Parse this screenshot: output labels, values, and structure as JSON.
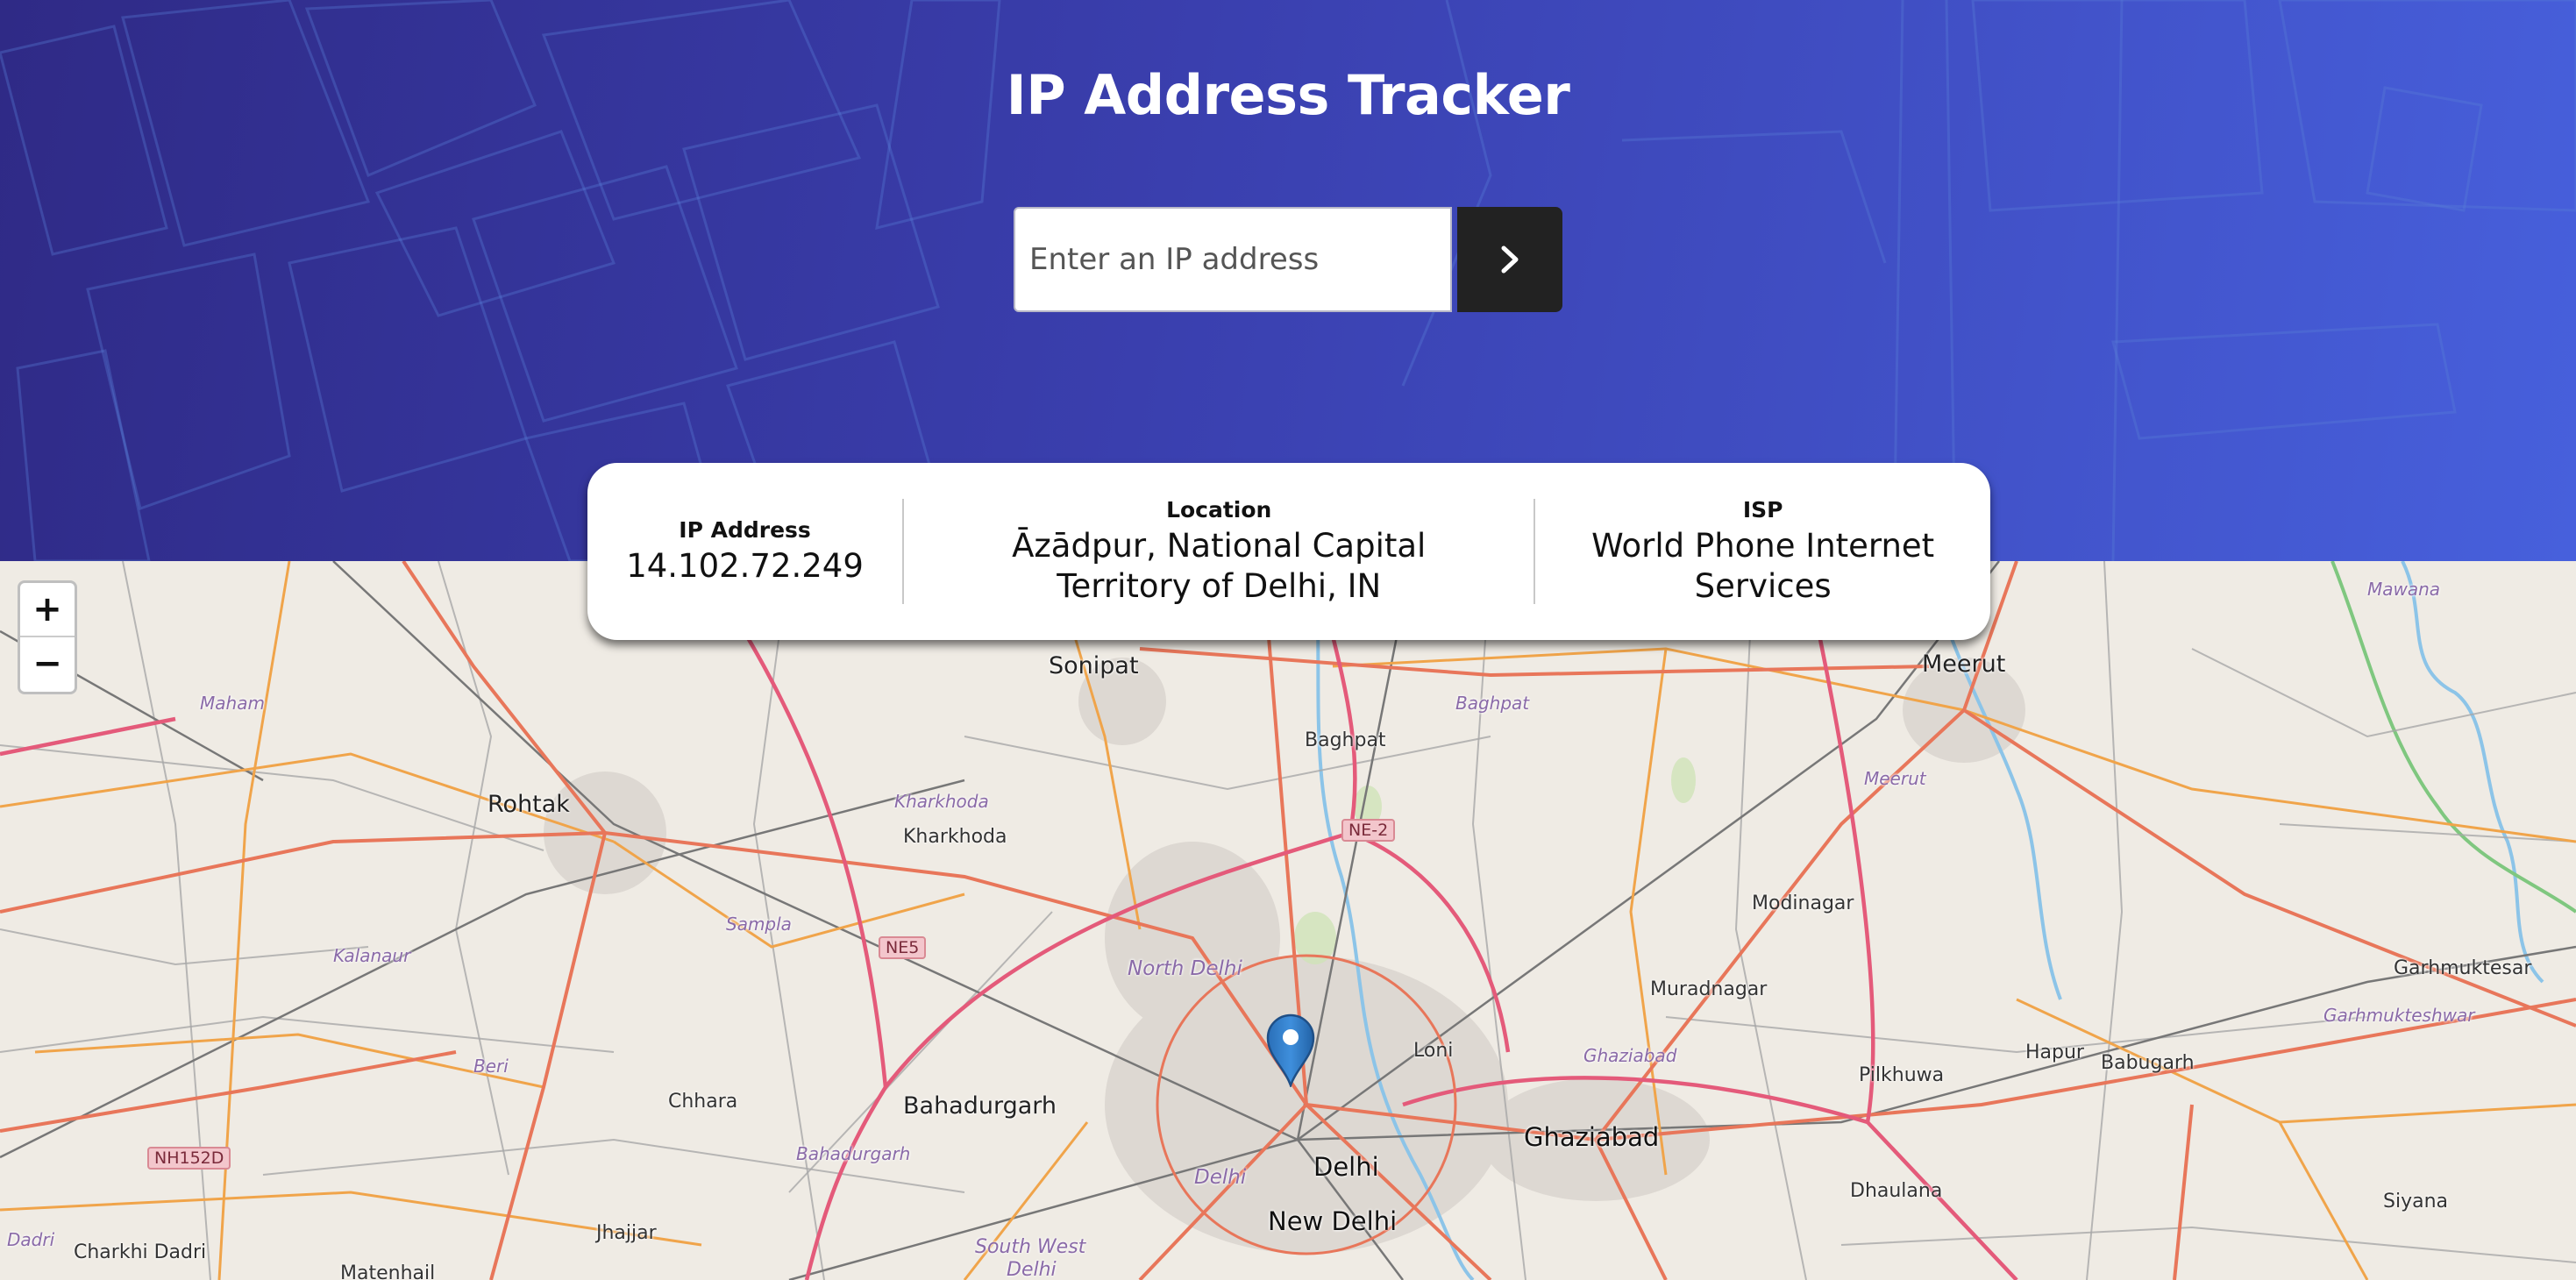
{
  "header": {
    "title": "IP Address Tracker",
    "search_placeholder": "Enter an IP address",
    "submit_icon": "chevron-right-icon"
  },
  "info": {
    "ip_label": "IP Address",
    "ip_value": "14.102.72.249",
    "location_label": "Location",
    "location_line1": "Āzādpur, National Capital",
    "location_line2": "Territory of Delhi, IN",
    "isp_label": "ISP",
    "isp_line1": "World Phone Internet",
    "isp_line2": "Services"
  },
  "map": {
    "zoom_in": "+",
    "zoom_out": "−",
    "marker_icon": "map-pin-icon",
    "places": {
      "sonipat": "Sonipat",
      "meerut": "Meerut",
      "mawana": "Mawana",
      "maham": "Maham",
      "baghpat_town": "Baghpat",
      "baghpat_dist": "Baghpat",
      "meerut_dist": "Meerut",
      "rohtak": "Rohtak",
      "kharkhoda_dist": "Kharkhoda",
      "kharkhoda": "Kharkhoda",
      "ne2": "NE-2",
      "modinagar": "Modinagar",
      "sampla": "Sampla",
      "ne5": "NE5",
      "kalanaur": "Kalanaur",
      "north_delhi": "North Delhi",
      "muradnagar": "Muradnagar",
      "garhmuktesar": "Garhmuktesar",
      "garhmukteshwar": "Garhmukteshwar",
      "loni": "Loni",
      "ghaziabad_dist": "Ghaziabad",
      "hapur": "Hapur",
      "babugarh": "Babugarh",
      "beri": "Beri",
      "chhara": "Chhara",
      "bahadurgarh": "Bahadurgarh",
      "pilkhuwa": "Pilkhuwa",
      "ghaziabad": "Ghaziabad",
      "nh152d": "NH152D",
      "bahadurgarh_dist": "Bahadurgarh",
      "delhi_dist": "Delhi",
      "delhi": "Delhi",
      "dhaulana": "Dhaulana",
      "siyana": "Siyana",
      "jhajjar": "Jhajjar",
      "new_delhi": "New Delhi",
      "dadri": "Dadri",
      "charkhi_dadri": "Charkhi Dadri",
      "south_west": "South West",
      "south_west_delhi": "Delhi",
      "matenhail": "Matenhail"
    }
  }
}
